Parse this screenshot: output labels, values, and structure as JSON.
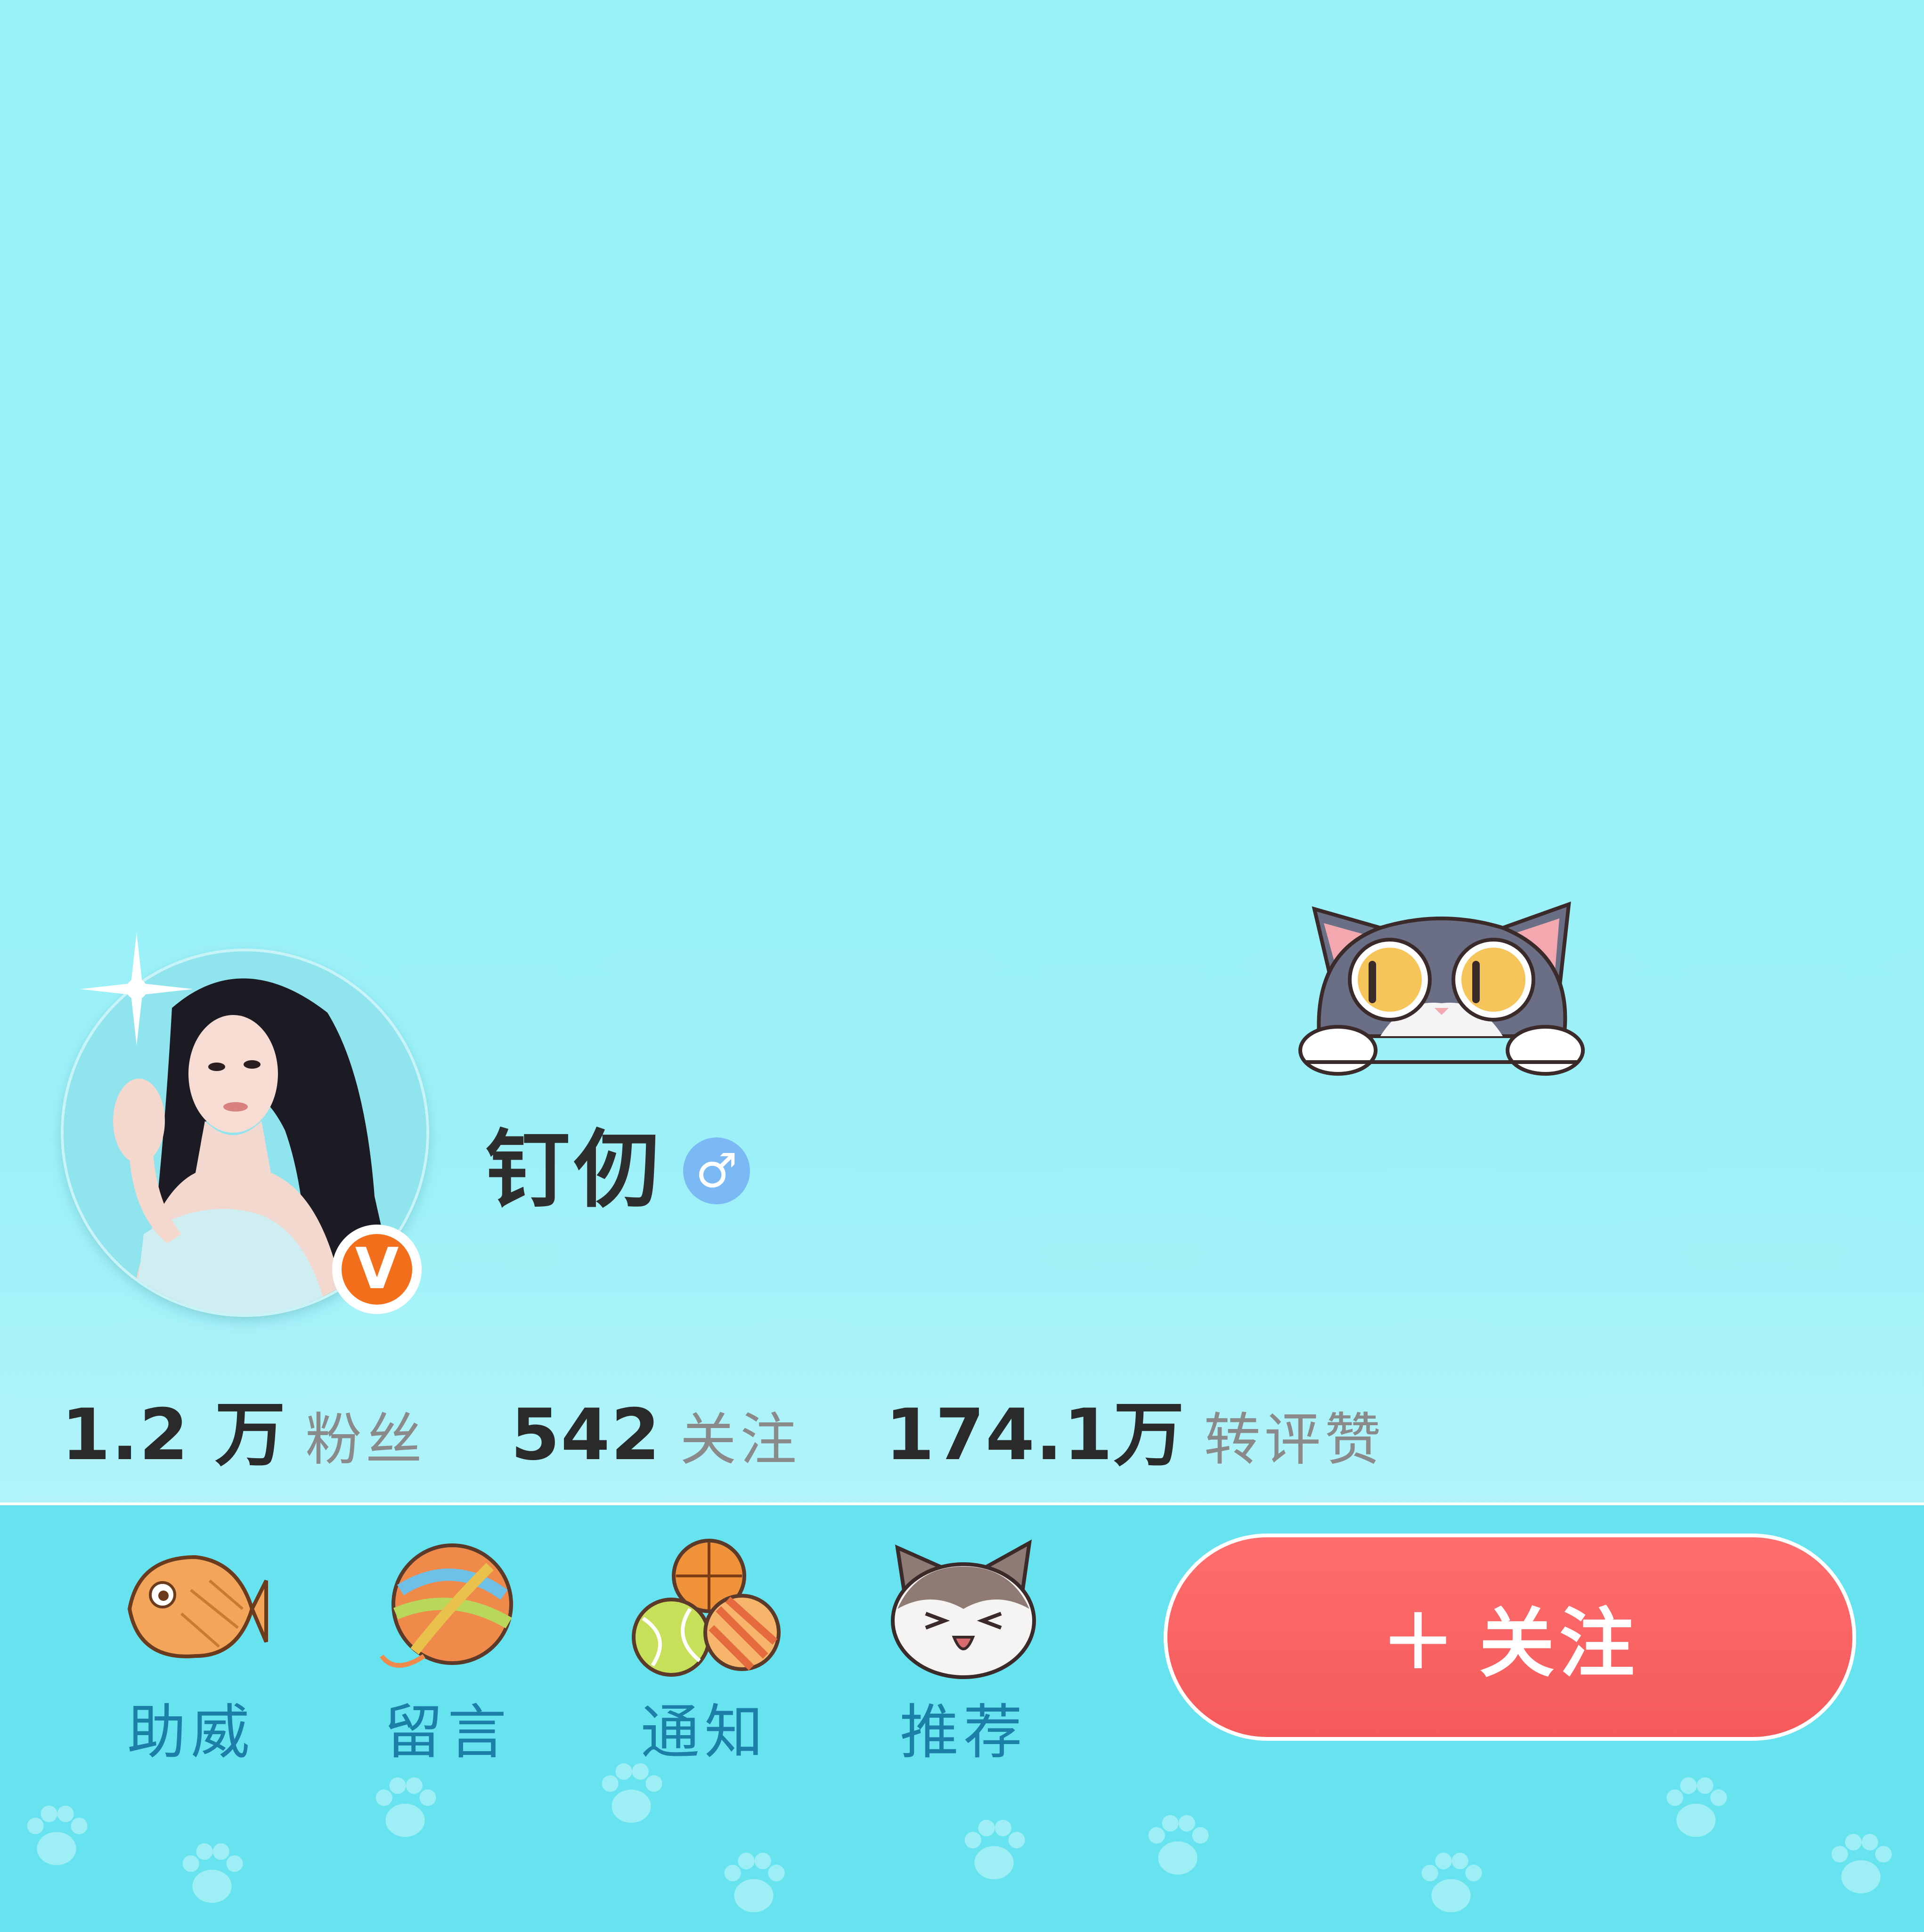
{
  "profile": {
    "name": "钉仞",
    "gender_symbol": "♂",
    "verified_badge": "V"
  },
  "stats": [
    {
      "value": "1.2 万",
      "label": "粉丝"
    },
    {
      "value": "542",
      "label": "关注"
    },
    {
      "value": "174.1万",
      "label": "转评赞"
    }
  ],
  "actions": [
    {
      "label": "助威",
      "icon": "fish-icon"
    },
    {
      "label": "留言",
      "icon": "yarn-ball-icon"
    },
    {
      "label": "通知",
      "icon": "balls-icon"
    },
    {
      "label": "推荐",
      "icon": "cat-face-icon"
    }
  ],
  "follow_button": {
    "plus": "+",
    "label": "关注"
  },
  "colors": {
    "background": "#9cf1f8",
    "bottom_bar": "#66e3ee",
    "follow_button": "#f55a5a",
    "action_label": "#1c7fa8",
    "verified_badge": "#f36f1c",
    "gender_badge": "#7ab9f4"
  }
}
